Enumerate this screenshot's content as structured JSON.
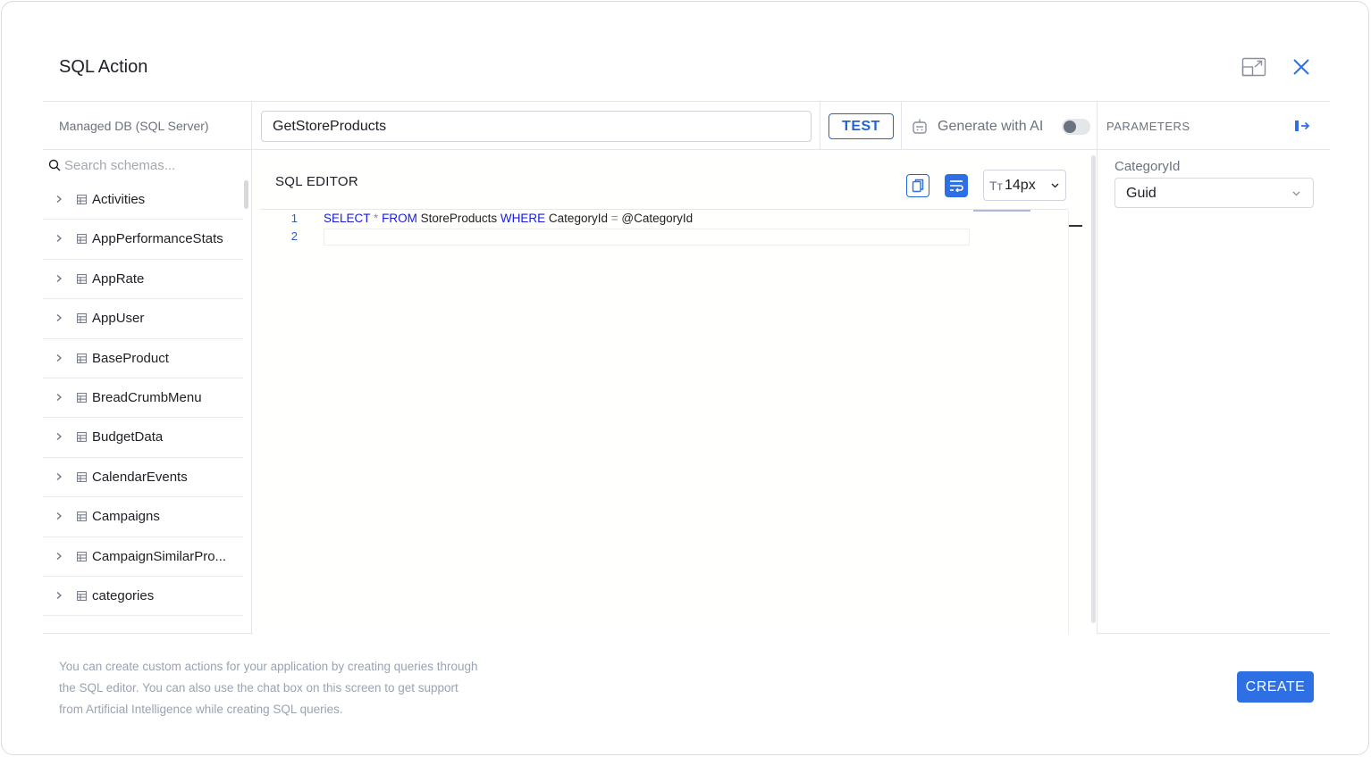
{
  "dialog": {
    "title": "SQL Action"
  },
  "header": {
    "expand_icon": "expand-window-icon",
    "close_icon": "close-icon"
  },
  "toolbar": {
    "db_label": "Managed DB (SQL Server)",
    "action_name_value": "GetStoreProducts",
    "test_label": "TEST",
    "ai_label": "Generate with AI",
    "ai_toggle_on": false,
    "parameters_label": "PARAMETERS"
  },
  "schema": {
    "search_placeholder": "Search schemas...",
    "items": [
      {
        "label": "Activities"
      },
      {
        "label": "AppPerformanceStats"
      },
      {
        "label": "AppRate"
      },
      {
        "label": "AppUser"
      },
      {
        "label": "BaseProduct"
      },
      {
        "label": "BreadCrumbMenu"
      },
      {
        "label": "BudgetData"
      },
      {
        "label": "CalendarEvents"
      },
      {
        "label": "Campaigns"
      },
      {
        "label": "CampaignSimilarPro..."
      },
      {
        "label": "categories"
      }
    ]
  },
  "editor": {
    "title": "SQL EDITOR",
    "font_size": "14px",
    "font_icon": "Tт",
    "line_numbers": [
      "1",
      "2"
    ],
    "code": {
      "kw1": "SELECT",
      "star": "*",
      "kw2": "FROM",
      "table": "StoreProducts",
      "kw3": "WHERE",
      "col": "CategoryId",
      "eq": "=",
      "param": "@CategoryId"
    }
  },
  "parameters": {
    "name": "CategoryId",
    "type": "Guid"
  },
  "footer": {
    "help_line1": "You can create custom actions for your application by creating queries through",
    "help_line2": "the SQL editor. You can also use the chat box on this screen to get support",
    "help_line3": "from Artificial Intelligence while creating SQL queries.",
    "create_label": "CREATE"
  },
  "colors": {
    "accent": "#2f6fe4",
    "keyword": "#1a1ae0",
    "muted_text": "#6b7280"
  }
}
